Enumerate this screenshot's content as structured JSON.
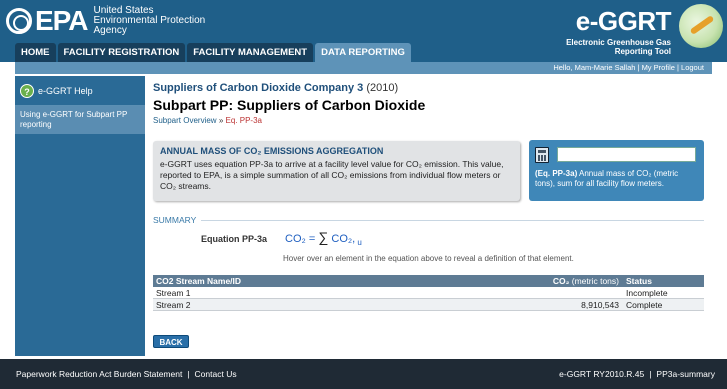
{
  "header": {
    "agency_line1": "United States",
    "agency_line2": "Environmental Protection",
    "agency_line3": "Agency",
    "epa_word": "EPA",
    "app_title": "e-GGRT",
    "app_sub1": "Electronic Greenhouse Gas",
    "app_sub2": "Reporting Tool"
  },
  "nav": {
    "tabs": [
      {
        "label": "HOME"
      },
      {
        "label": "FACILITY REGISTRATION"
      },
      {
        "label": "FACILITY MANAGEMENT"
      },
      {
        "label": "DATA REPORTING"
      }
    ]
  },
  "userbar": {
    "greeting": "Hello, Mam-Marie Sallah",
    "profile": "My Profile",
    "logout": "Logout"
  },
  "sidebar": {
    "help_label": "e-GGRT Help",
    "help_icon": "?",
    "link_label": "Using e-GGRT for Subpart PP reporting"
  },
  "main": {
    "company": "Suppliers of Carbon Dioxide Company 3",
    "year": "(2010)",
    "title": "Subpart PP: Suppliers of Carbon Dioxide",
    "breadcrumb_link": "Subpart Overview",
    "breadcrumb_sep": " » ",
    "breadcrumb_current": "Eq. PP-3a",
    "info_title": "ANNUAL MASS OF CO₂ EMISSIONS AGGREGATION",
    "info_text": "e-GGRT uses equation PP-3a to arrive at a facility level value for CO₂ emission. This value, reported to EPA, is a simple summation of all CO₂ emissions from individual flow meters or CO₂ streams.",
    "calc_input_value": "",
    "calc_desc_bold": "(Eq. PP-3a)",
    "calc_desc_text": " Annual mass of CO₂ (metric tons), sum for all facility flow meters.",
    "summary_label": "SUMMARY",
    "eq_label": "Equation PP-3a",
    "eq_lhs": "CO₂",
    "eq_eq": " = ",
    "eq_sigma": "∑",
    "eq_rhs": " CO₂,",
    "eq_sub": " u",
    "eq_hint": "Hover over an element in the equation above to reveal a definition of that element.",
    "table": {
      "headers": {
        "name": "CO2 Stream Name/ID",
        "value_main": "CO₂",
        "value_unit": " (metric tons)",
        "status": "Status"
      },
      "rows": [
        {
          "name": "Stream 1",
          "value": "",
          "status": "Incomplete"
        },
        {
          "name": "Stream 2",
          "value": "8,910,543",
          "status": "Complete"
        }
      ]
    },
    "back_label": "BACK"
  },
  "footer": {
    "paperwork": "Paperwork Reduction Act Burden Statement",
    "contact": "Contact Us",
    "version": "e-GGRT RY2010.R.45",
    "page_id": "PP3a-summary"
  }
}
